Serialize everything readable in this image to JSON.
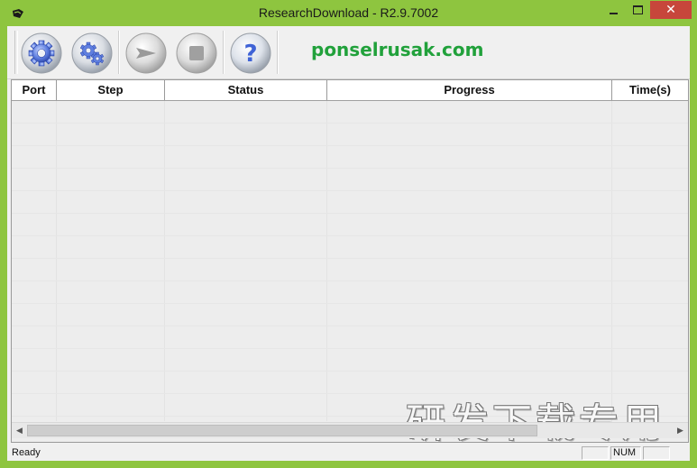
{
  "window": {
    "title": "ResearchDownload - R2.9.7002",
    "close_glyph": "✕",
    "accent_color": "#8ec53f",
    "close_color": "#c7463b"
  },
  "toolbar": {
    "buttons": [
      {
        "name": "load-packet-button",
        "icon": "gear-icon"
      },
      {
        "name": "settings-button",
        "icon": "gears-icon"
      },
      {
        "name": "start-download-button",
        "icon": "play-arrow-icon"
      },
      {
        "name": "stop-download-button",
        "icon": "stop-square-icon"
      },
      {
        "name": "help-button",
        "icon": "question-mark-icon",
        "glyph": "?"
      }
    ],
    "brand": "ponselrusak.com",
    "brand_color": "#21a13b"
  },
  "table": {
    "columns": [
      "Port",
      "Step",
      "Status",
      "Progress",
      "Time(s)"
    ],
    "rows": []
  },
  "watermark": "研发下载专用",
  "statusbar": {
    "status": "Ready",
    "num_indicator": "NUM"
  }
}
